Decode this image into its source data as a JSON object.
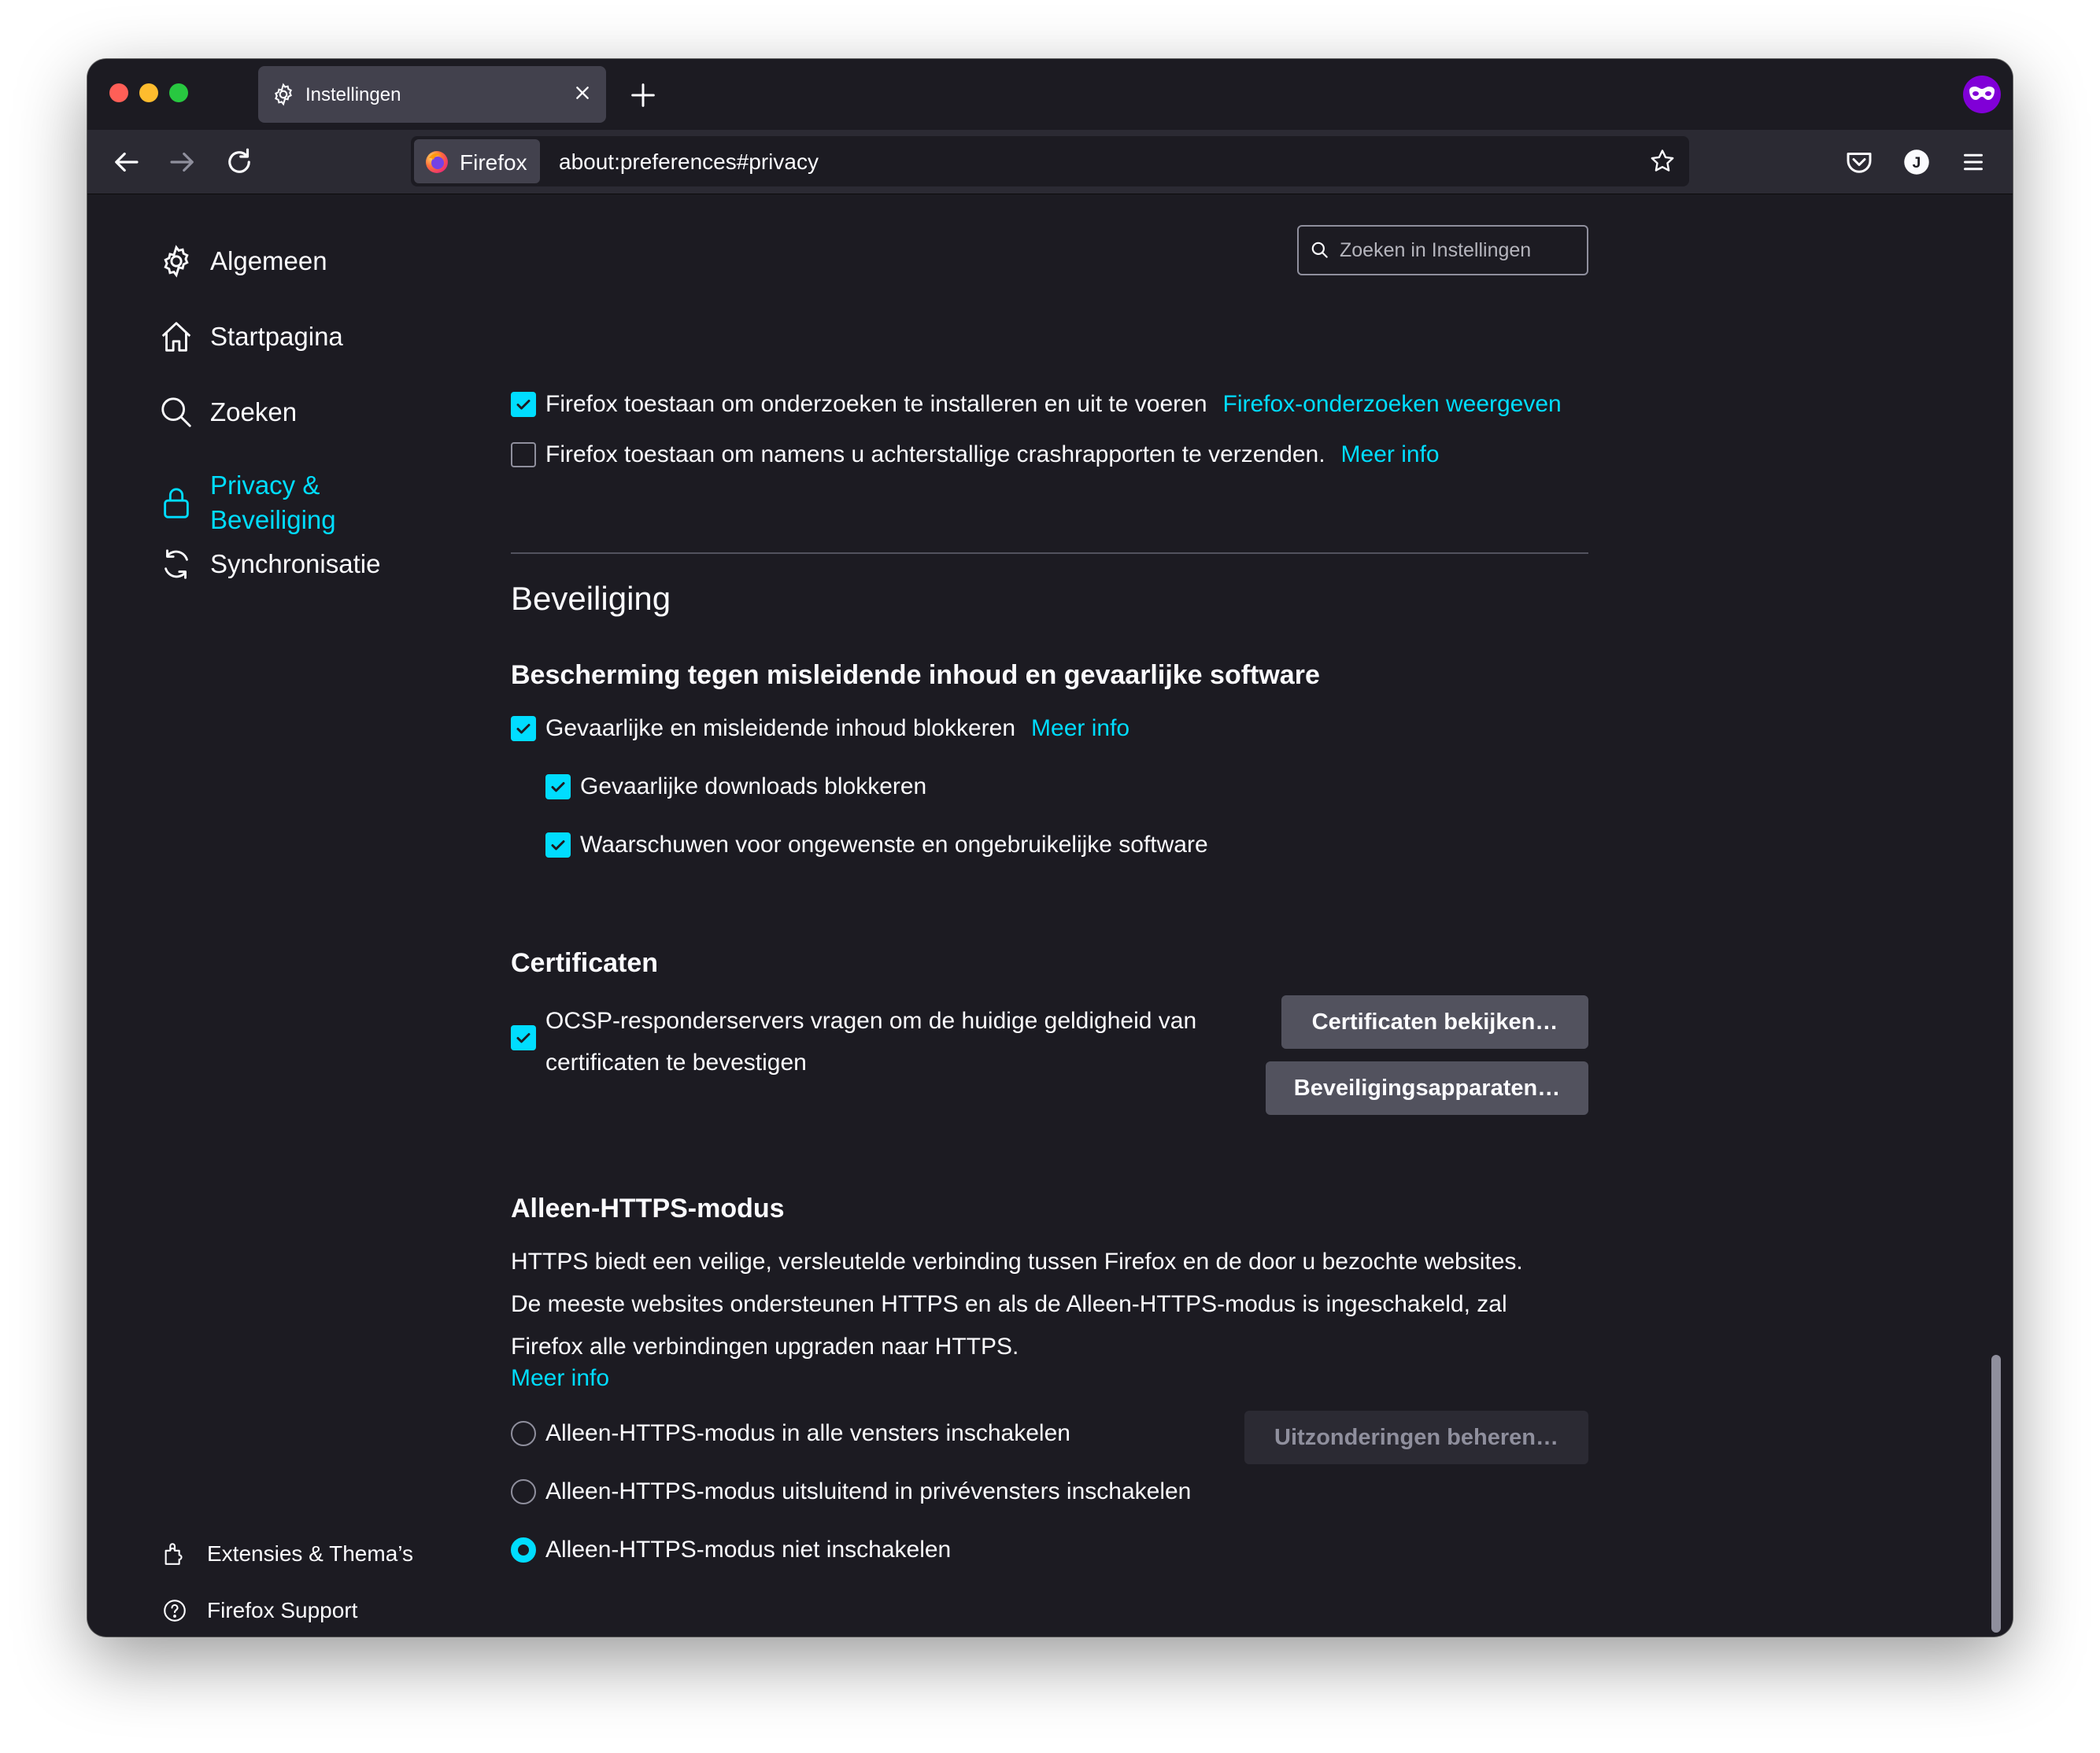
{
  "window": {
    "tab_title": "Instellingen"
  },
  "toolbar": {
    "identity_label": "Firefox",
    "url": "about:preferences#privacy"
  },
  "search": {
    "placeholder": "Zoeken in Instellingen"
  },
  "sidebar": {
    "items": [
      {
        "label": "Algemeen",
        "icon": "gear-icon"
      },
      {
        "label": "Startpagina",
        "icon": "home-icon"
      },
      {
        "label": "Zoeken",
        "icon": "search-icon"
      },
      {
        "label": "Privacy & Beveiliging",
        "line1": "Privacy &",
        "line2": "Beveiliging",
        "icon": "lock-icon",
        "selected": true
      },
      {
        "label": "Synchronisatie",
        "icon": "sync-icon"
      }
    ],
    "footer": [
      {
        "label": "Extensies & Thema’s",
        "icon": "puzzle-icon"
      },
      {
        "label": "Firefox Support",
        "icon": "help-icon"
      }
    ]
  },
  "data_collection": {
    "studies": {
      "label": "Firefox toestaan om onderzoeken te installeren en uit te voeren",
      "checked": true,
      "link": "Firefox-onderzoeken weergeven"
    },
    "crash_reports": {
      "label": "Firefox toestaan om namens u achterstallige crashrapporten te verzenden.",
      "checked": false,
      "link": "Meer info"
    }
  },
  "security": {
    "title": "Beveiliging",
    "protection": {
      "heading": "Bescherming tegen misleidende inhoud en gevaarlijke software",
      "block_dangerous": {
        "label": "Gevaarlijke en misleidende inhoud blokkeren",
        "checked": true,
        "link": "Meer info"
      },
      "block_downloads": {
        "label": "Gevaarlijke downloads blokkeren",
        "checked": true
      },
      "warn_unwanted": {
        "label": "Waarschuwen voor ongewenste en ongebruikelijke software",
        "checked": true
      }
    },
    "certificates": {
      "heading": "Certificaten",
      "ocsp_line1": "OCSP-responderservers vragen om de huidige geldigheid van",
      "ocsp_line2": "certificaten te bevestigen",
      "ocsp_checked": true,
      "view_button": "Certificaten bekijken…",
      "devices_button": "Beveiligingsapparaten…"
    },
    "https_only": {
      "heading": "Alleen-HTTPS-modus",
      "desc_line1": "HTTPS biedt een veilige, versleutelde verbinding tussen Firefox en de door u bezochte websites.",
      "desc_line2": "De meeste websites ondersteunen HTTPS en als de Alleen-HTTPS-modus is ingeschakeld, zal",
      "desc_line3": "Firefox alle verbindingen upgraden naar HTTPS.",
      "more_info": "Meer info",
      "exceptions_button": "Uitzonderingen beheren…",
      "options": [
        {
          "label": "Alleen-HTTPS-modus in alle vensters inschakelen",
          "selected": false
        },
        {
          "label": "Alleen-HTTPS-modus uitsluitend in privévensters inschakelen",
          "selected": false
        },
        {
          "label": "Alleen-HTTPS-modus niet inschakelen",
          "selected": true
        }
      ]
    }
  },
  "colors": {
    "accent": "#00ddff",
    "background": "#1c1b22",
    "toolbar": "#2b2a33",
    "button": "#52525e",
    "private_browsing": "#8000d7"
  }
}
